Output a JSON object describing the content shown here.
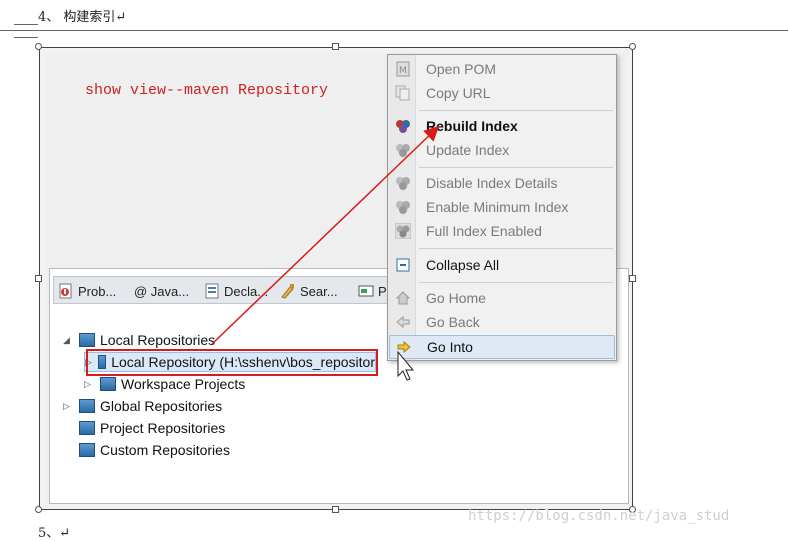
{
  "document": {
    "heading_line": "4、 构建索引↵",
    "footer_line": "5、↵",
    "watermark": "https://blog.csdn.net/java_stud"
  },
  "annotation": {
    "text": "show view--maven Repository",
    "color": "#d12020"
  },
  "view_tabs": [
    {
      "label": "Prob...",
      "icon": "problems-icon"
    },
    {
      "label": "@ Java...",
      "icon": "javadoc-icon"
    },
    {
      "label": "Decla...",
      "icon": "declaration-icon"
    },
    {
      "label": "Sear...",
      "icon": "search-icon"
    },
    {
      "label": "P",
      "icon": "progress-icon"
    }
  ],
  "tree": {
    "items": [
      {
        "label": "Local Repositories",
        "expanded": true,
        "level": 0
      },
      {
        "label": "Local Repository (H:\\sshenv\\bos_repositor",
        "expanded": false,
        "level": 1,
        "selected": true
      },
      {
        "label": "Workspace Projects",
        "expanded": false,
        "level": 1
      },
      {
        "label": "Global Repositories",
        "expanded": false,
        "level": 0
      },
      {
        "label": "Project Repositories",
        "level": 0
      },
      {
        "label": "Custom Repositories",
        "level": 0
      }
    ]
  },
  "context_menu": {
    "items": [
      {
        "label": "Open POM",
        "enabled": false,
        "icon": "pom-file-icon"
      },
      {
        "label": "Copy URL",
        "enabled": false,
        "icon": "copy-icon"
      },
      {
        "label": "Rebuild Index",
        "enabled": true,
        "icon": "rebuild-index-icon"
      },
      {
        "label": "Update Index",
        "enabled": false,
        "icon": "update-index-icon"
      },
      {
        "label": "Disable Index Details",
        "enabled": false,
        "icon": "index-details-icon"
      },
      {
        "label": "Enable Minimum Index",
        "enabled": false,
        "icon": "minimum-index-icon"
      },
      {
        "label": "Full Index Enabled",
        "enabled": false,
        "icon": "full-index-icon"
      },
      {
        "label": "Collapse All",
        "enabled": true,
        "icon": "collapse-all-icon"
      },
      {
        "label": "Go Home",
        "enabled": false,
        "icon": "home-icon"
      },
      {
        "label": "Go Back",
        "enabled": false,
        "icon": "back-arrow-icon"
      },
      {
        "label": "Go Into",
        "enabled": true,
        "icon": "go-into-arrow-icon",
        "highlighted": true
      }
    ]
  }
}
